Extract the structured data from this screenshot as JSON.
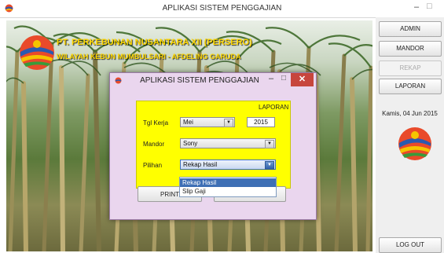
{
  "window": {
    "title": "APLIKASI SISTEM PENGGAJIAN",
    "min_glyph": "–",
    "max_glyph": "□"
  },
  "header": {
    "company": "PT. PERKEBUNAN NUSANTARA XII (PERSERO)",
    "subtitle": "WILAYAH KEBUN MUMBULSARI - AFDELING GARUDA"
  },
  "sidebar": {
    "buttons": [
      {
        "label": "ADMIN",
        "enabled": true
      },
      {
        "label": "MANDOR",
        "enabled": true
      },
      {
        "label": "REKAP",
        "enabled": false
      },
      {
        "label": "LAPORAN",
        "enabled": true
      }
    ],
    "date": "Kamis, 04 Jun 2015",
    "logout_label": "LOG OUT"
  },
  "dialog": {
    "title": "APLIKASI SISTEM PENGGAJIAN",
    "min_glyph": "–",
    "max_glyph": "□",
    "close_glyph": "✕",
    "panel_heading": "LAPORAN",
    "fields": {
      "tgl_kerja": {
        "label": "Tgl Kerja",
        "month": "Mei",
        "year": "2015"
      },
      "mandor": {
        "label": "Mandor",
        "value": "Sony"
      },
      "pilihan": {
        "label": "Pilihan",
        "value": "Rekap Hasil",
        "options": [
          "Rekap Hasil",
          "Slip Gaji"
        ]
      }
    },
    "print_label": "PRINT"
  },
  "icons": {
    "app": "logo-icon",
    "dropdown": "chevron-down-icon",
    "close": "close-icon"
  },
  "colors": {
    "accent_yellow": "#ffff00",
    "header_text": "#ffd800",
    "dialog_bg": "#ead6ee",
    "close_red": "#c7463d",
    "selection_blue": "#3e6fb5"
  }
}
